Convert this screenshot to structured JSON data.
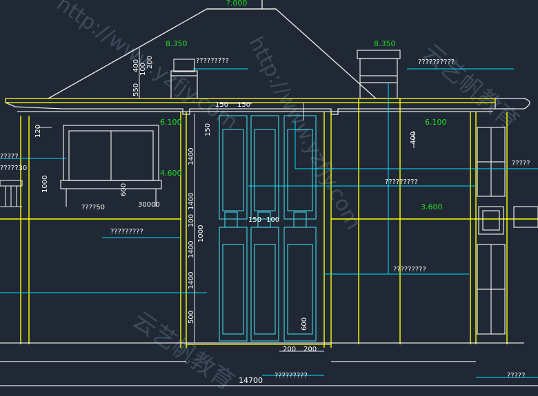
{
  "canvas": {
    "background": "#1f2834"
  },
  "colors": {
    "outline": "#e8e8e8",
    "wall": "#ffff00",
    "panel": "#40c8d8",
    "dim": "#ffffff",
    "level": "#22dd22",
    "leader": "#00e0ff",
    "watermark": "#3c4a5a"
  },
  "levels": {
    "ridge": "?.000",
    "left_eave": "8.350",
    "right_eave": "8.350",
    "left_upper": "6.100",
    "right_upper": "6.100",
    "left_mid": "4.600",
    "right_mid": "3.600"
  },
  "dimensions": {
    "d550": "550",
    "d400a": "400",
    "d100a": "100",
    "d200a": "200",
    "d150a": "150",
    "d150b": "150",
    "d150c": "150",
    "d120": "120",
    "d1400a": "1400",
    "d1000": "1000",
    "d600": "600",
    "d1400b": "1400",
    "d100b": "100",
    "d1000c": "1000",
    "d150d": "150",
    "d100c": "100",
    "d1400c": "1400",
    "d1400d": "1400",
    "d600b": "600",
    "d500": "500",
    "d200b": "200",
    "d200c": "200",
    "d400b": "400",
    "total_width": "14700"
  },
  "labels": {
    "note_roof_left": "?????????",
    "note_roof_right": "??????????",
    "note_left_a": "?????",
    "note_left_b": "?????30",
    "note_left_c": "????50",
    "note_left_d": "30000",
    "note_center": "?????????",
    "note_mid_right": "?????????",
    "note_right_edge": "?????",
    "note_lower_right": "?????????",
    "note_bottom": "?????????",
    "note_bottom_right": "?????"
  },
  "watermark": {
    "url_a": "http://www.yzfjy.com",
    "url_b": "http://www.yzfjy.com",
    "brand_a": "云艺帆教育",
    "brand_b": "云艺帆教育"
  }
}
